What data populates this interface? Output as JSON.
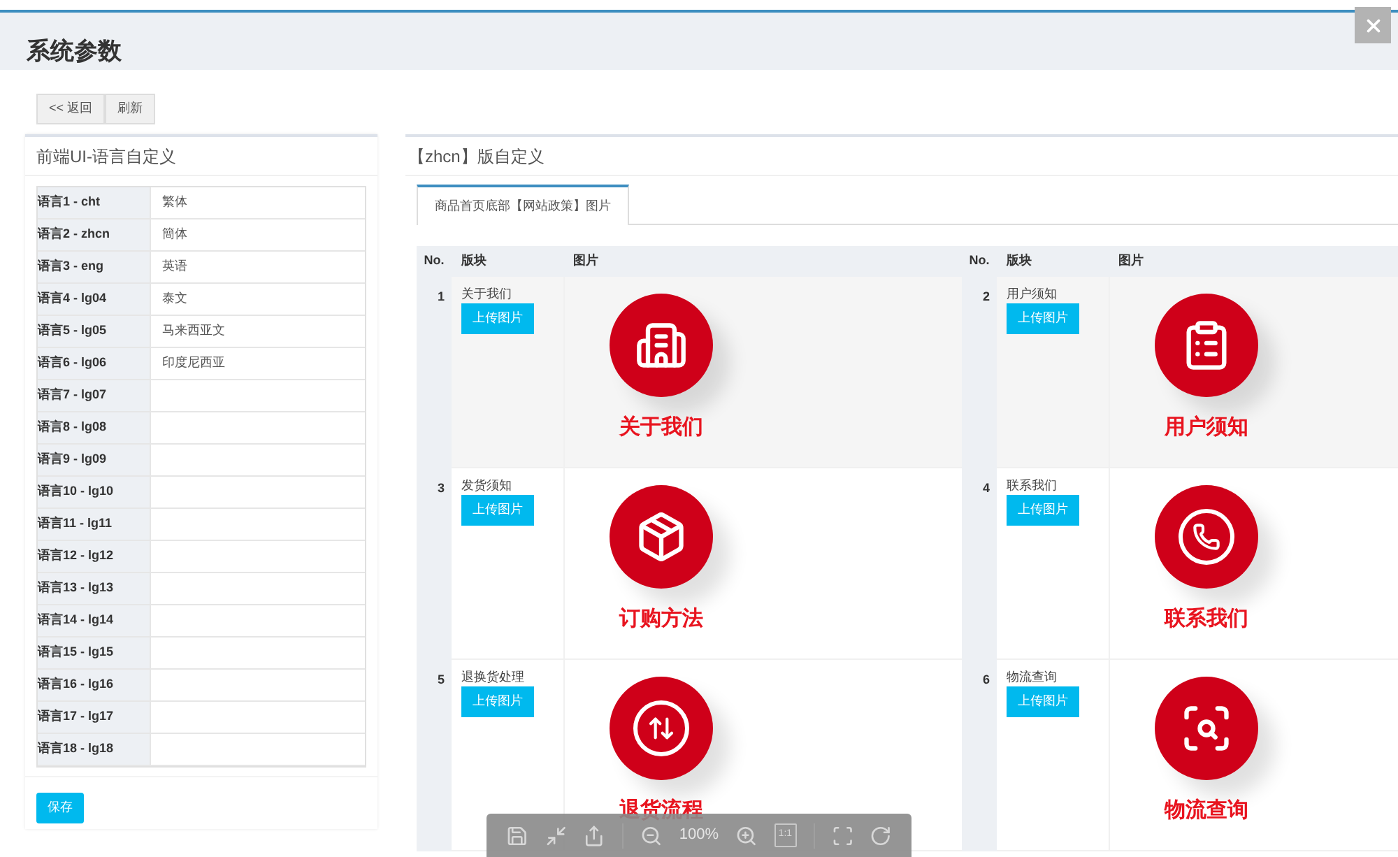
{
  "window": {
    "title": "系统参数"
  },
  "toolbar": [
    {
      "label": "<< 返回"
    },
    {
      "label": "刷新"
    }
  ],
  "languages_panel": {
    "title": "前端UI-语言自定义",
    "rows": [
      {
        "label": "语言1 - cht",
        "value": "繁体"
      },
      {
        "label": "语言2 - zhcn",
        "value": "簡体"
      },
      {
        "label": "语言3 - eng",
        "value": "英语"
      },
      {
        "label": "语言4 - lg04",
        "value": "泰文"
      },
      {
        "label": "语言5 - lg05",
        "value": "马来西亚文"
      },
      {
        "label": "语言6 - lg06",
        "value": "印度尼西亚"
      },
      {
        "label": "语言7 - lg07"
      },
      {
        "label": "语言8 - lg08"
      },
      {
        "label": "语言9 - lg09"
      },
      {
        "label": "语言10 - lg10"
      },
      {
        "label": "语言11 - lg11"
      },
      {
        "label": "语言12 - lg12"
      },
      {
        "label": "语言13 - lg13"
      },
      {
        "label": "语言14 - lg14"
      },
      {
        "label": "语言15 - lg15"
      },
      {
        "label": "语言16 - lg16"
      },
      {
        "label": "语言17 - lg17"
      },
      {
        "label": "语言18 - lg18"
      }
    ],
    "save_button": "保存"
  },
  "custom_panel": {
    "title": "【zhcn】版自定义",
    "tabs": [
      {
        "label": "商品首页底部【网站政策】图片",
        "selected": true
      }
    ],
    "columns": [
      "No.",
      "版块",
      "图片",
      "No.",
      "版块",
      "图片"
    ],
    "items": [
      {
        "no": "1",
        "name": "关于我们",
        "button": "上传图片",
        "caption": "关于我们"
      },
      {
        "no": "2",
        "name": "用户须知",
        "button": "上传图片",
        "caption": "用户须知"
      },
      {
        "no": "3",
        "name": "发货须知",
        "button": "上传图片",
        "caption": "订购方法"
      },
      {
        "no": "4",
        "name": "联系我们",
        "button": "上传图片",
        "caption": "联系我们"
      },
      {
        "no": "5",
        "name": "退换货处理",
        "button": "上传图片",
        "caption": "退货流程"
      },
      {
        "no": "6",
        "name": "物流查询",
        "button": "上传图片",
        "caption": "物流查询"
      }
    ]
  },
  "image_viewer_bar": {
    "zoom": "100%",
    "actual_size": "1:1"
  }
}
